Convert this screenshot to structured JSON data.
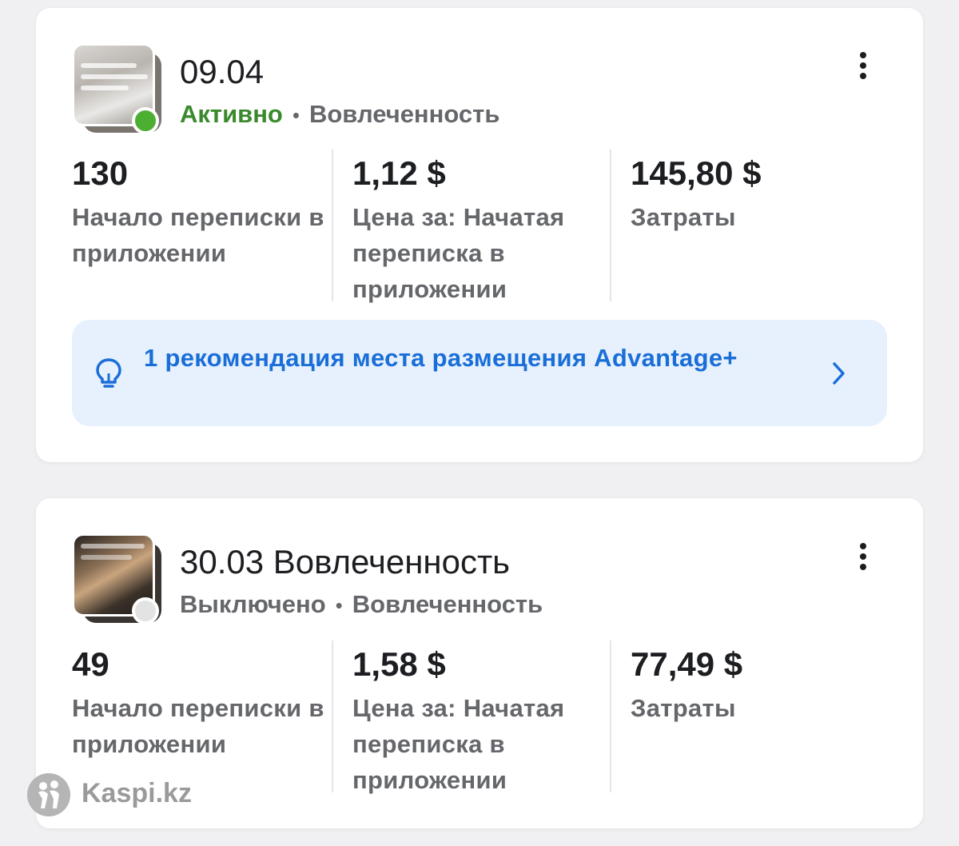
{
  "campaigns": [
    {
      "title": "09.04",
      "status": "Активно",
      "status_color": "#4caf32",
      "separator": "•",
      "goal": "Вовлеченность",
      "metrics": [
        {
          "value": "130",
          "label": "Начало переписки в приложении"
        },
        {
          "value": "1,12 $",
          "label": "Цена за: Начатая переписка в приложении"
        },
        {
          "value": "145,80 $",
          "label": "Затраты"
        }
      ],
      "recommendation": {
        "icon": "lightbulb-icon",
        "text": "1 рекомендация места размещения Advantage+",
        "arrow_icon": "chevron-right-icon"
      }
    },
    {
      "title": "30.03 Вовлеченность",
      "status": "Выключено",
      "status_color": "#e3e3e3",
      "separator": "•",
      "goal": "Вовлеченность",
      "metrics": [
        {
          "value": "49",
          "label": "Начало переписки в приложении"
        },
        {
          "value": "1,58 $",
          "label": "Цена за: Начатая переписка в приложении"
        },
        {
          "value": "77,49 $",
          "label": "Затраты"
        }
      ]
    }
  ],
  "watermark": {
    "text": "Kaspi.kz"
  },
  "colors": {
    "accent_blue": "#1a6ed8",
    "recommendation_bg": "#e7f1fd",
    "active_green": "#3a8a2c"
  }
}
